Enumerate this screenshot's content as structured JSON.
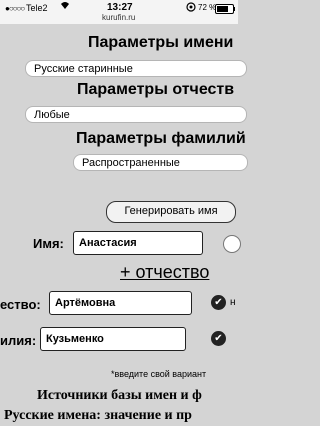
{
  "status_bar": {
    "signal_dots": "●○○○○",
    "carrier": "Tele2",
    "time": "13:27",
    "domain": "kurufin.ru",
    "battery_percent": "72 %",
    "battery_level": 0.72
  },
  "name_params": {
    "heading": "Параметры имени",
    "selected": "Русские старинные"
  },
  "patronymic_params": {
    "heading": "Параметры отчеств",
    "selected": "Любые"
  },
  "surname_params": {
    "heading": "Параметры фамилий",
    "selected": "Распространенные"
  },
  "generate_button": "Генерировать имя",
  "name_field": {
    "label": "Имя:",
    "value": "Анастасия"
  },
  "add_patronymic_link": "+ отчество",
  "patronymic_field": {
    "label": "ество:",
    "value": "Артёмовна",
    "trailing": "н"
  },
  "surname_field": {
    "label": "илия:",
    "value": "Кузьменко"
  },
  "hint": "*введите свой вариант",
  "sources_heading": "Источники базы имен и ф",
  "meanings_heading": "Русские имена: значение и пр",
  "icons": {
    "check": "✔"
  }
}
